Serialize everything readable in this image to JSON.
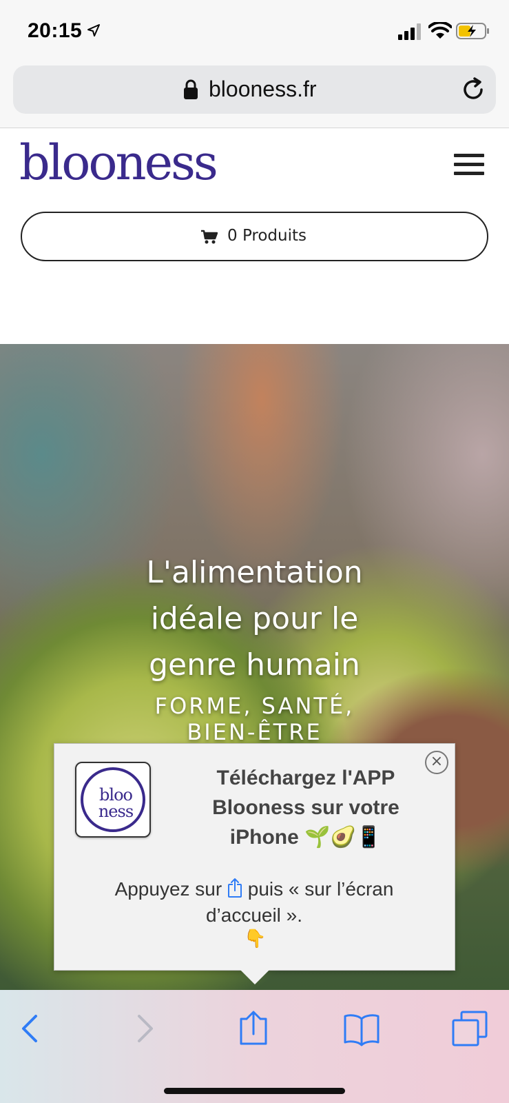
{
  "status_bar": {
    "time": "20:15"
  },
  "browser": {
    "url": "blooness.fr"
  },
  "site": {
    "logo_text": "blooness",
    "cart_label": "0 Produits"
  },
  "hero": {
    "title": "L'alimentation\nidéale pour le\ngenre humain",
    "subtitle": "FORME, SANTÉ,\nBIEN-ÊTRE"
  },
  "popup": {
    "app_icon_text": "bloo\nness",
    "close_glyph": "×",
    "heading": "Téléchargez l'APP\nBlooness sur votre\niPhone 🌱🥑📱",
    "body_before": "Appuyez sur",
    "body_after": "puis « sur l’écran d’accueil ».",
    "hand": "👇"
  },
  "colors": {
    "brand": "#3a2a8c",
    "ios_blue": "#2f7cf6",
    "toolbar_disabled": "#b9b9c4"
  },
  "icons": {
    "status": [
      "location-arrow-icon",
      "signal-icon",
      "wifi-icon",
      "battery-icon"
    ],
    "toolbar": [
      "back-icon",
      "forward-icon",
      "share-icon",
      "bookmarks-icon",
      "tabs-icon"
    ]
  }
}
